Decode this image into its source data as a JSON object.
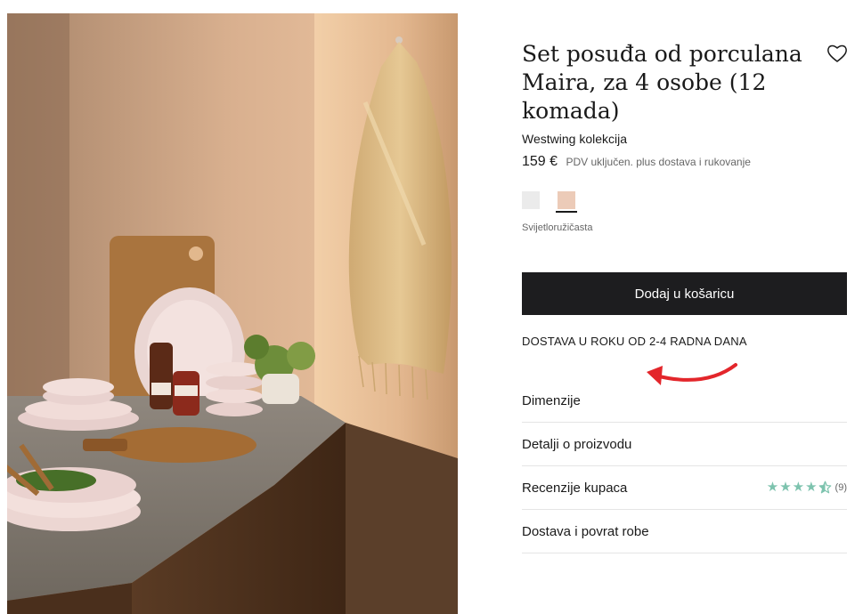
{
  "product": {
    "title": "Set posuđa od porculana Maira, za 4 osobe (12 komada)",
    "brand": "Westwing kolekcija",
    "price": "159 €",
    "price_note": "PDV uključen. plus dostava i rukovanje"
  },
  "colors": {
    "options": [
      {
        "name": "white-swatch",
        "hex": "#ebebeb"
      },
      {
        "name": "light-pink-swatch",
        "hex": "#eccbb8"
      }
    ],
    "selected_label": "Svijetloružičasta"
  },
  "cart": {
    "add_label": "Dodaj u košaricu"
  },
  "delivery": {
    "text": "DOSTAVA U ROKU OD 2-4 RADNA DANA"
  },
  "accordion": {
    "items": [
      {
        "label": "Dimenzije"
      },
      {
        "label": "Detalji o proizvodu"
      },
      {
        "label": "Recenzije kupaca"
      },
      {
        "label": "Dostava i povrat robe"
      }
    ]
  },
  "reviews": {
    "rating": 4.5,
    "max": 5,
    "count": "(9)"
  },
  "icons": {
    "wishlist": "heart-icon",
    "annotation": "red-arrow-icon",
    "star": "star-icon"
  },
  "theme": {
    "button_bg": "#1d1d1f",
    "star_color": "#7dc3ae",
    "arrow_color": "#e3262b",
    "divider": "#e5e5e5"
  }
}
